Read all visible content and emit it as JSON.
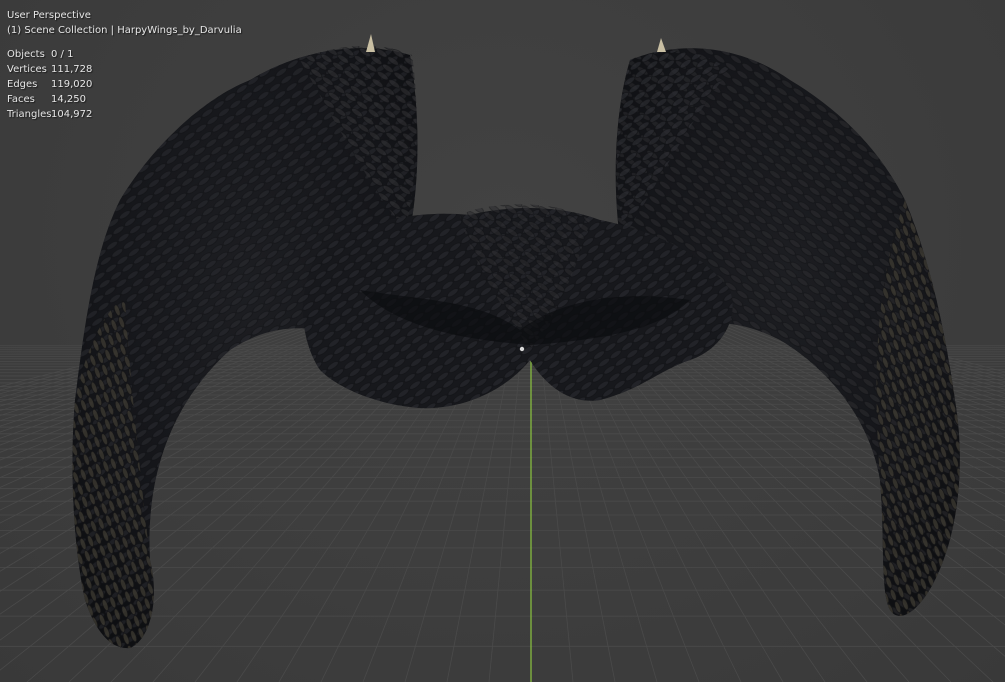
{
  "viewport": {
    "view_name": "User Perspective",
    "collection_line": "(1) Scene Collection | HarpyWings_by_Darvulia",
    "stats": [
      {
        "label": "Objects",
        "value": "0 / 1"
      },
      {
        "label": "Vertices",
        "value": "111,728"
      },
      {
        "label": "Edges",
        "value": "119,020"
      },
      {
        "label": "Faces",
        "value": "14,250"
      },
      {
        "label": "Triangles",
        "value": "104,972"
      }
    ]
  },
  "colors": {
    "background": "#3c3c3c",
    "grid_line": "#4a4a4a",
    "y_axis": "#8cc63f",
    "feather_dark": "#15161a",
    "feather_mid": "#26272c",
    "feather_light": "#3d3a33",
    "horn": "#c9bfa3"
  }
}
